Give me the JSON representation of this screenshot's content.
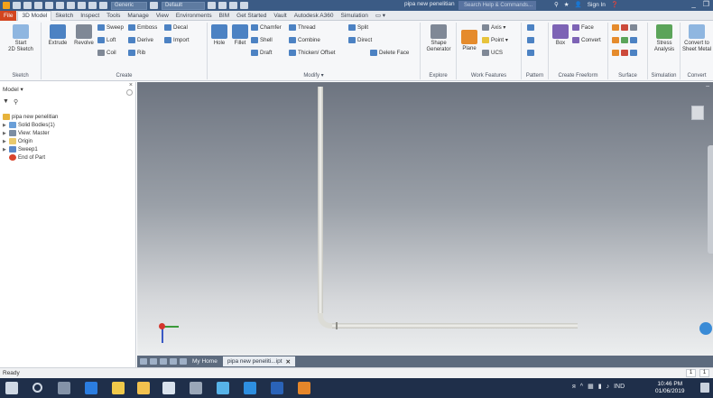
{
  "titlebar": {
    "appearance_value": "Generic",
    "material_value": "Default",
    "doc_title": "pipa new penelitian",
    "search_placeholder": "Search Help & Commands...",
    "sign_in": "Sign In"
  },
  "menu_tabs": [
    "File",
    "3D Model",
    "Sketch",
    "Inspect",
    "Tools",
    "Manage",
    "View",
    "Environments",
    "BIM",
    "Get Started",
    "Vault",
    "Autodesk A360",
    "Simulation"
  ],
  "active_tab": "3D Model",
  "ribbon": {
    "sketch": {
      "label": "Sketch",
      "start": "Start",
      "start2": "2D Sketch"
    },
    "create": {
      "label": "Create",
      "extrude": "Extrude",
      "revolve": "Revolve",
      "sweep": "Sweep",
      "loft": "Loft",
      "coil": "Coil",
      "emboss": "Emboss",
      "derive": "Derive",
      "rib": "Rib",
      "decal": "Decal",
      "import": "Import"
    },
    "modify": {
      "label": "Modify ▾",
      "hole": "Hole",
      "fillet": "Fillet",
      "chamfer": "Chamfer",
      "shell": "Shell",
      "draft": "Draft",
      "thread": "Thread",
      "combine": "Combine",
      "thicken": "Thicken/ Offset",
      "split": "Split",
      "direct": "Direct",
      "delete_face": "Delete Face"
    },
    "explore": {
      "label": "Explore",
      "shape": "Shape",
      "shape2": "Generator"
    },
    "work_features": {
      "label": "Work Features",
      "plane": "Plane",
      "axis": "Axis ▾",
      "point": "Point ▾",
      "ucs": "UCS"
    },
    "pattern": {
      "label": "Pattern"
    },
    "freeform": {
      "label": "Create Freeform",
      "box": "Box",
      "face": "Face",
      "convert": "Convert"
    },
    "surface": {
      "label": "Surface"
    },
    "simulation": {
      "label": "Simulation",
      "stress": "Stress",
      "stress2": "Analysis"
    },
    "convert": {
      "label": "Convert",
      "sheet": "Convert to",
      "sheet2": "Sheet Metal"
    }
  },
  "browser": {
    "header": "Model ▾",
    "tree": [
      {
        "label": "pipa new penelitian",
        "icon": "part-icon"
      },
      {
        "label": "Solid Bodies(1)",
        "icon": "solid-bodies-icon"
      },
      {
        "label": "View: Master",
        "icon": "view-icon"
      },
      {
        "label": "Origin",
        "icon": "folder-icon"
      },
      {
        "label": "Sweep1",
        "icon": "sweep-icon"
      },
      {
        "label": "End of Part",
        "icon": "end-of-part-icon"
      }
    ]
  },
  "doc_tabs": {
    "home": "My Home",
    "current": "pipa new peneliti...ipt"
  },
  "status": {
    "text": "Ready",
    "num1": "1",
    "num2": "1"
  },
  "taskbar": {
    "tray_lang": "IND",
    "time": "10:46 PM",
    "date": "01/06/2019"
  },
  "colors": {
    "title_bar": "#3b5b85",
    "file_tab": "#d2451f",
    "viewport_top": "#6d7480",
    "viewport_bottom": "#eceeef",
    "taskbar": "#1f2f4a"
  }
}
